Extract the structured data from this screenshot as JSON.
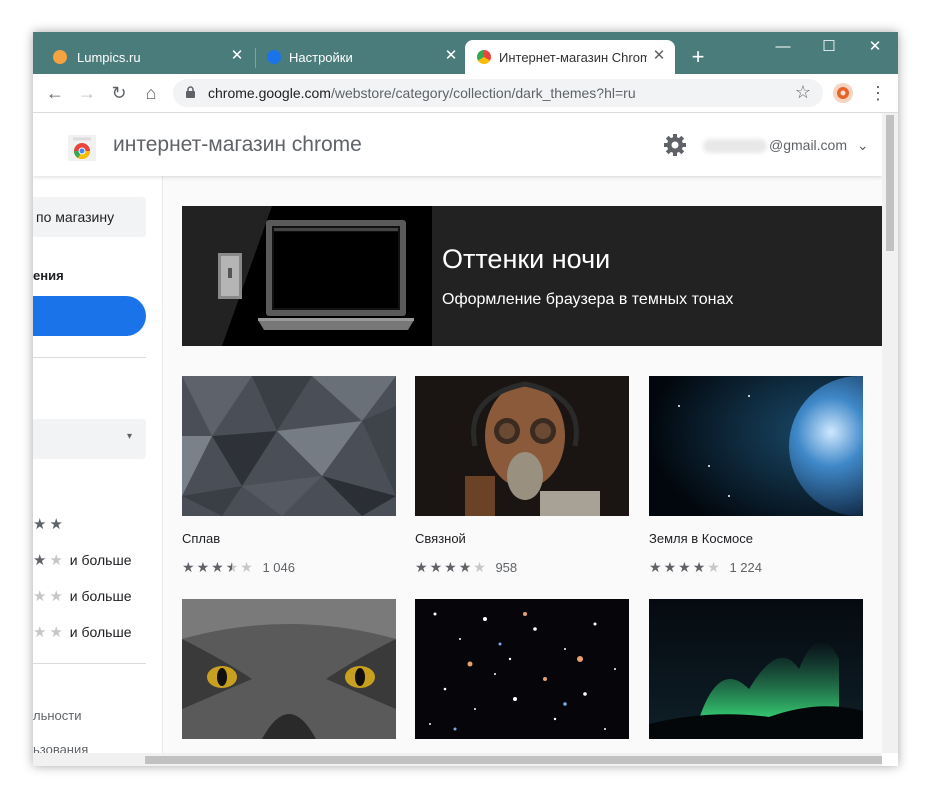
{
  "tabs": [
    {
      "title": "Lumpics.ru",
      "favicon": "orange-favicon-icon",
      "color": "#f4a340",
      "close": "✕"
    },
    {
      "title": "Настройки",
      "favicon": "gear-favicon-icon",
      "color": "#1a73e8",
      "close": "✕"
    },
    {
      "title": "Интернет-магазин Chrome",
      "favicon": "webstore-favicon-icon",
      "color": "#e8453c",
      "close": "✕"
    }
  ],
  "new_tab": "+",
  "window_controls": {
    "minimize": "—",
    "maximize": "☐",
    "close": "✕"
  },
  "toolbar": {
    "back": "←",
    "forward": "→",
    "reload": "↻",
    "home": "⌂",
    "star": "☆",
    "menu": "⋮"
  },
  "address": {
    "host": "chrome.google.com",
    "path": "/webstore/category/collection/dark_themes?hl=ru"
  },
  "store": {
    "name": "интернет-магазин chrome",
    "account_suffix": "@gmail.com",
    "account_caret": "⌄"
  },
  "sidebar": {
    "search_text": "по магазину",
    "heading": "ения",
    "select_caret": "▾",
    "star_rows": [
      {
        "text": "",
        "stars": [
          "on",
          "on"
        ]
      },
      {
        "text": "и больше",
        "stars": [
          "on",
          "off"
        ]
      },
      {
        "text": "и больше",
        "stars": [
          "off",
          "off"
        ]
      },
      {
        "text": "и больше",
        "stars": [
          "off",
          "off"
        ]
      }
    ],
    "bottom_text_1": "льности",
    "bottom_text_2": "ьзования"
  },
  "banner": {
    "title": "Оттенки ночи",
    "subtitle": "Оформление браузера в темных тонах"
  },
  "themes": [
    {
      "title": "Сплав",
      "rating": 3.5,
      "count": "1 046",
      "stars": [
        "on",
        "on",
        "on",
        "half",
        "off"
      ]
    },
    {
      "title": "Связной",
      "rating": 4,
      "count": "958",
      "stars": [
        "on",
        "on",
        "on",
        "on",
        "off"
      ]
    },
    {
      "title": "Земля в Космосе",
      "rating": 4,
      "count": "1 224",
      "stars": [
        "on",
        "on",
        "on",
        "on",
        "off"
      ]
    },
    {
      "title": "",
      "count": ""
    },
    {
      "title": "",
      "count": ""
    },
    {
      "title": "",
      "count": ""
    }
  ],
  "colors": {
    "tabbar": "#4b7c7c",
    "accent": "#1a73e8",
    "banner": "#222222"
  }
}
